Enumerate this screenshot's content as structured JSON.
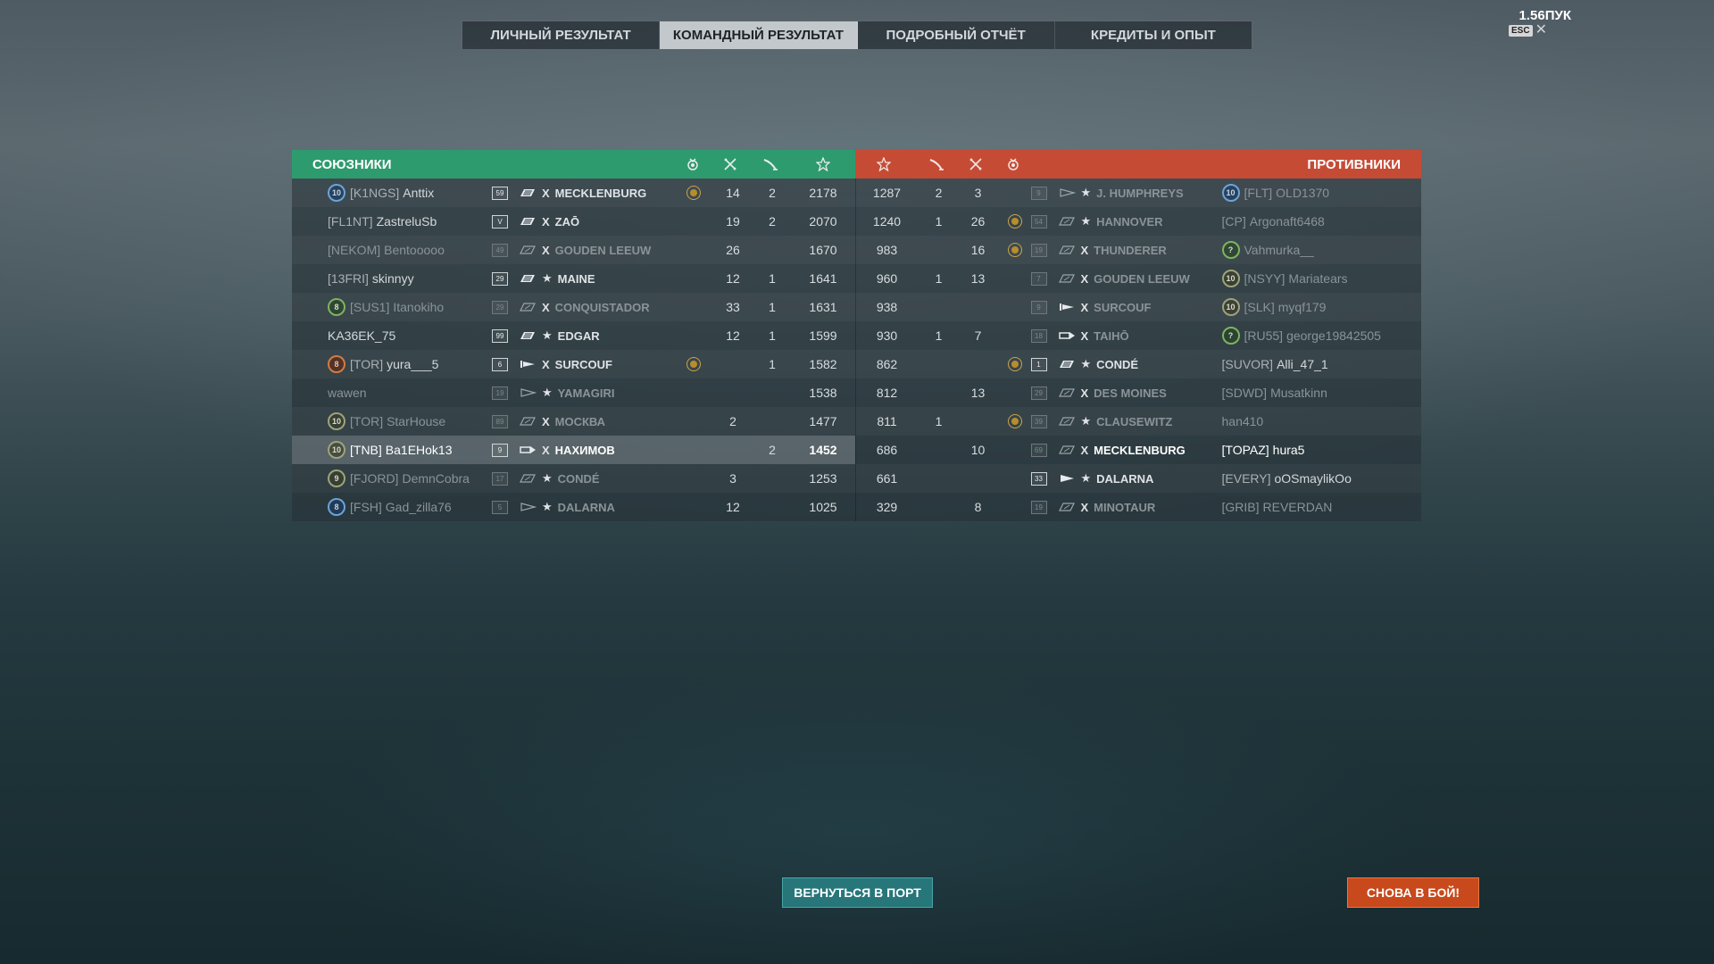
{
  "top_tabs": [
    {
      "label": "ЛИЧНЫЙ РЕЗУЛЬТАТ",
      "active": false
    },
    {
      "label": "КОМАНДНЫЙ РЕЗУЛЬТАТ",
      "active": true
    },
    {
      "label": "ПОДРОБНЫЙ ОТЧЁТ",
      "active": false
    },
    {
      "label": "КРЕДИТЫ И ОПЫТ",
      "active": false
    }
  ],
  "top_right_label": "1.56ПУК",
  "esc_label": "ESC",
  "allies_title": "СОЮЗНИКИ",
  "enemies_title": "ПРОТИВНИКИ",
  "header_icons": {
    "allies": [
      "medal-icon",
      "planes-icon",
      "torpedo-icon",
      "star-icon"
    ],
    "enemies": [
      "star-icon",
      "torpedo-icon",
      "planes-icon",
      "medal-icon"
    ]
  },
  "colors": {
    "allies": "#2e9b6e",
    "enemies": "#c64b35",
    "port_button": "#27767a",
    "battle_button": "#c7491c"
  },
  "allies": [
    {
      "badge": "10",
      "badge_color": "blue",
      "clan": "[K1NGS]",
      "name": "Anttix",
      "level": "59",
      "ship_type": "battleship",
      "prefix": "X",
      "ship": "MECKLENBURG",
      "medal": true,
      "planes": "14",
      "torpedo": "2",
      "exp": "2178",
      "dim": false
    },
    {
      "badge": "",
      "badge_color": "",
      "clan": "[FL1NT]",
      "name": "ZastreluSb",
      "level": "V",
      "ship_type": "battleship",
      "prefix": "X",
      "ship": "ZAŌ",
      "medal": false,
      "planes": "19",
      "torpedo": "2",
      "exp": "2070",
      "dim": false
    },
    {
      "badge": "",
      "badge_color": "",
      "clan": "[NEKOM]",
      "name": "Bentooooo",
      "level": "49",
      "ship_type": "cruiser",
      "prefix": "X",
      "ship": "GOUDEN LEEUW",
      "medal": false,
      "planes": "26",
      "torpedo": "",
      "exp": "1670",
      "dim": true
    },
    {
      "badge": "",
      "badge_color": "",
      "clan": "[13FRI]",
      "name": "skinnyy",
      "level": "29",
      "ship_type": "battleship",
      "prefix": "★",
      "ship": "MAINE",
      "medal": false,
      "planes": "12",
      "torpedo": "1",
      "exp": "1641",
      "dim": false
    },
    {
      "badge": "8",
      "badge_color": "green",
      "clan": "[SUS1]",
      "name": "Itanokiho",
      "level": "29",
      "ship_type": "cruiser",
      "prefix": "X",
      "ship": "CONQUISTADOR",
      "medal": false,
      "planes": "33",
      "torpedo": "1",
      "exp": "1631",
      "dim": true
    },
    {
      "badge": "",
      "badge_color": "",
      "clan": "",
      "name": "KA36EK_75",
      "level": "99",
      "ship_type": "battleship",
      "prefix": "★",
      "ship": "EDGAR",
      "medal": false,
      "planes": "12",
      "torpedo": "1",
      "exp": "1599",
      "dim": false
    },
    {
      "badge": "8",
      "badge_color": "orange",
      "clan": "[TOR]",
      "name": "yura___5",
      "level": "6",
      "ship_type": "submarine",
      "prefix": "X",
      "ship": "SURCOUF",
      "medal": true,
      "planes": "",
      "torpedo": "1",
      "exp": "1582",
      "dim": false
    },
    {
      "badge": "",
      "badge_color": "",
      "clan": "",
      "name": "wawen",
      "level": "19",
      "ship_type": "destroyer",
      "prefix": "★",
      "ship": "YAMAGIRI",
      "medal": false,
      "planes": "",
      "torpedo": "",
      "exp": "1538",
      "dim": true
    },
    {
      "badge": "10",
      "badge_color": "olive",
      "clan": "[TOR]",
      "name": "StarHouse",
      "level": "89",
      "ship_type": "cruiser",
      "prefix": "X",
      "ship": "МОСКВА",
      "medal": false,
      "planes": "2",
      "torpedo": "",
      "exp": "1477",
      "dim": true
    },
    {
      "badge": "10",
      "badge_color": "olive",
      "clan": "[TNB]",
      "name": "Ba1EHok13",
      "level": "9",
      "ship_type": "carrier",
      "prefix": "X",
      "ship": "НАХИМОВ",
      "medal": false,
      "planes": "",
      "torpedo": "2",
      "exp": "1452",
      "dim": false,
      "selected": true
    },
    {
      "badge": "9",
      "badge_color": "olive",
      "clan": "[FJORD]",
      "name": "DemnCobra",
      "level": "17",
      "ship_type": "cruiser",
      "prefix": "★",
      "ship": "CONDÉ",
      "medal": false,
      "planes": "3",
      "torpedo": "",
      "exp": "1253",
      "dim": true
    },
    {
      "badge": "8",
      "badge_color": "blue",
      "clan": "[FSH]",
      "name": "Gad_zilla76",
      "level": "5",
      "ship_type": "destroyer",
      "prefix": "★",
      "ship": "DALARNA",
      "medal": false,
      "planes": "12",
      "torpedo": "",
      "exp": "1025",
      "dim": true
    }
  ],
  "enemies": [
    {
      "exp": "1287",
      "torpedo": "2",
      "planes": "3",
      "medal": false,
      "level": "9",
      "ship_type": "destroyer",
      "prefix": "★",
      "ship": "J. HUMPHREYS",
      "badge": "10",
      "badge_color": "blue",
      "clan": "[FLT]",
      "name": "OLD1370",
      "dim": true
    },
    {
      "exp": "1240",
      "torpedo": "1",
      "planes": "26",
      "medal": true,
      "level": "54",
      "ship_type": "cruiser",
      "prefix": "★",
      "ship": "HANNOVER",
      "badge": "",
      "badge_color": "",
      "clan": "[CP]",
      "name": "Argonaft6468",
      "dim": true
    },
    {
      "exp": "983",
      "torpedo": "",
      "planes": "16",
      "medal": true,
      "level": "19",
      "ship_type": "cruiser",
      "prefix": "X",
      "ship": "THUNDERER",
      "badge": "?",
      "badge_color": "green",
      "clan": "",
      "name": "Vahmurka__",
      "dim": true
    },
    {
      "exp": "960",
      "torpedo": "1",
      "planes": "13",
      "medal": false,
      "level": "7",
      "ship_type": "cruiser",
      "prefix": "X",
      "ship": "GOUDEN LEEUW",
      "badge": "10",
      "badge_color": "olive",
      "clan": "[NSYY]",
      "name": "Mariatears",
      "dim": true
    },
    {
      "exp": "938",
      "torpedo": "",
      "planes": "",
      "medal": false,
      "level": "9",
      "ship_type": "submarine",
      "prefix": "X",
      "ship": "SURCOUF",
      "badge": "10",
      "badge_color": "olive",
      "clan": "[SLK]",
      "name": "myqf179",
      "dim": true
    },
    {
      "exp": "930",
      "torpedo": "1",
      "planes": "7",
      "medal": false,
      "level": "18",
      "ship_type": "carrier",
      "prefix": "X",
      "ship": "TAIHŌ",
      "badge": "?",
      "badge_color": "green",
      "clan": "[RU55]",
      "name": "george19842505",
      "dim": true
    },
    {
      "exp": "862",
      "torpedo": "",
      "planes": "",
      "medal": true,
      "level": "1",
      "ship_type": "battleship",
      "prefix": "★",
      "ship": "CONDÉ",
      "badge": "",
      "badge_color": "",
      "clan": "[SUVOR]",
      "name": "Alli_47_1",
      "dim": false
    },
    {
      "exp": "812",
      "torpedo": "",
      "planes": "13",
      "medal": false,
      "level": "29",
      "ship_type": "cruiser",
      "prefix": "X",
      "ship": "DES MOINES",
      "badge": "",
      "badge_color": "",
      "clan": "[SDWD]",
      "name": "Musatkinn",
      "dim": true
    },
    {
      "exp": "811",
      "torpedo": "1",
      "planes": "",
      "medal": true,
      "level": "39",
      "ship_type": "cruiser",
      "prefix": "★",
      "ship": "CLAUSEWITZ",
      "badge": "",
      "badge_color": "",
      "clan": "",
      "name": "han410",
      "dim": true
    },
    {
      "exp": "686",
      "torpedo": "",
      "planes": "10",
      "medal": false,
      "level": "69",
      "ship_type": "cruiser",
      "prefix": "X",
      "ship": "MECKLENBURG",
      "badge": "",
      "badge_color": "",
      "clan": "[TOPAZ]",
      "name": "hura5",
      "dim": true
    },
    {
      "exp": "661",
      "torpedo": "",
      "planes": "",
      "medal": false,
      "level": "33",
      "ship_type": "destroyer-bold",
      "prefix": "★",
      "ship": "DALARNA",
      "badge": "",
      "badge_color": "",
      "clan": "[EVERY]",
      "name": "oOSmaylikOo",
      "dim": false
    },
    {
      "exp": "329",
      "torpedo": "",
      "planes": "8",
      "medal": false,
      "level": "19",
      "ship_type": "cruiser",
      "prefix": "X",
      "ship": "MINOTAUR",
      "badge": "",
      "badge_color": "",
      "clan": "[GRIB]",
      "name": "REVERDAN",
      "dim": true
    }
  ],
  "buttons": {
    "port": "ВЕРНУТЬСЯ В ПОРТ",
    "battle": "СНОВА В БОЙ!"
  }
}
